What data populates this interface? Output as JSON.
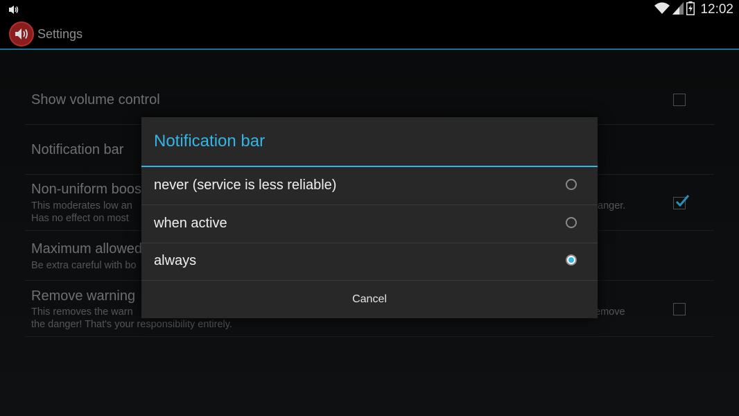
{
  "status_bar": {
    "time": "12:02",
    "icons": [
      "volume-icon",
      "wifi-icon",
      "signal-icon",
      "battery-icon"
    ]
  },
  "action_bar": {
    "title": "Settings",
    "app_icon": "speaker-icon"
  },
  "preferences": [
    {
      "title": "Show volume control",
      "checkbox": "unchecked"
    },
    {
      "title": "Notification bar"
    },
    {
      "title": "Non-uniform boos",
      "summary_line1": "This moderates low an",
      "summary_line1_tail": "anger.",
      "summary_line2": "Has no effect on most",
      "checkbox": "checked"
    },
    {
      "title": "Maximum allowed",
      "summary_line1": "Be extra careful with bo"
    },
    {
      "title": "Remove warning",
      "summary_line1": "This removes the warn",
      "summary_line1_tail": "emove",
      "summary_line2": "the danger! That's your responsibility entirely.",
      "checkbox": "unchecked"
    }
  ],
  "dialog": {
    "title": "Notification bar",
    "options": [
      {
        "label": "never (service is less reliable)",
        "selected": false
      },
      {
        "label": "when active",
        "selected": false
      },
      {
        "label": "always",
        "selected": true
      }
    ],
    "cancel_label": "Cancel"
  },
  "colors": {
    "accent": "#33b5e5",
    "dialog_bg": "#282828",
    "app_icon_bg": "#8a1e1e"
  }
}
